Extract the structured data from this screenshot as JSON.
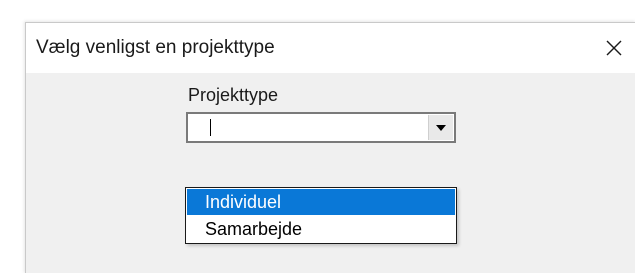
{
  "dialog": {
    "title": "Vælg venligst en projekttype",
    "close_icon": "close-icon",
    "colors": {
      "title_bg": "#ffffff",
      "body_bg": "#f0f0f0",
      "selection": "#0a78d7"
    }
  },
  "form": {
    "label": "Projekttype",
    "combobox": {
      "value": "",
      "dropdown_icon": "chevron-down-icon",
      "options": [
        "Individuel",
        "Samarbejde"
      ],
      "highlighted": "Individuel"
    }
  }
}
